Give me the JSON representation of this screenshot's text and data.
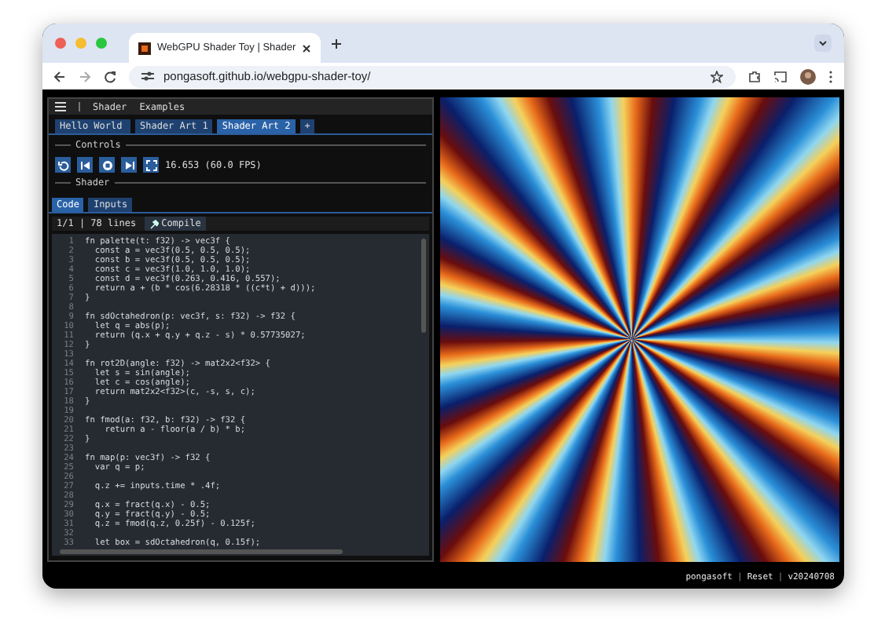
{
  "browser": {
    "tab_title": "WebGPU Shader Toy | Shader",
    "url": "pongasoft.github.io/webgpu-shader-toy/"
  },
  "menu": [
    "Shader",
    "Examples"
  ],
  "shader_tabs": [
    {
      "label": "Hello World",
      "selected": false
    },
    {
      "label": "Shader Art 1",
      "selected": false
    },
    {
      "label": "Shader Art 2",
      "selected": true
    }
  ],
  "add_tab": "+",
  "controls": {
    "heading": "Controls",
    "fps": "16.653 (60.0 FPS)"
  },
  "shader": {
    "heading": "Shader",
    "tabs": [
      {
        "label": "Code",
        "selected": true
      },
      {
        "label": "Inputs",
        "selected": false
      }
    ],
    "status": "1/1 | 78 lines",
    "compile": "Compile"
  },
  "code_lines": [
    {
      "number": "1",
      "text": "fn palette(t: f32) -> vec3f {"
    },
    {
      "number": "2",
      "text": "  const a = vec3f(0.5, 0.5, 0.5);"
    },
    {
      "number": "3",
      "text": "  const b = vec3f(0.5, 0.5, 0.5);"
    },
    {
      "number": "4",
      "text": "  const c = vec3f(1.0, 1.0, 1.0);"
    },
    {
      "number": "5",
      "text": "  const d = vec3f(0.263, 0.416, 0.557);"
    },
    {
      "number": "6",
      "text": "  return a + (b * cos(6.28318 * ((c*t) + d)));"
    },
    {
      "number": "7",
      "text": "}"
    },
    {
      "number": "8"
    },
    {
      "number": "9",
      "text": "fn sdOctahedron(p: vec3f, s: f32) -> f32 {"
    },
    {
      "number": "10",
      "text": "  let q = abs(p);"
    },
    {
      "number": "11",
      "text": "  return (q.x + q.y + q.z - s) * 0.57735027;"
    },
    {
      "number": "12",
      "text": "}"
    },
    {
      "number": "13"
    },
    {
      "number": "14",
      "text": "fn rot2D(angle: f32) -> mat2x2<f32> {"
    },
    {
      "number": "15",
      "text": "  let s = sin(angle);"
    },
    {
      "number": "16",
      "text": "  let c = cos(angle);"
    },
    {
      "number": "17",
      "text": "  return mat2x2<f32>(c, -s, s, c);"
    },
    {
      "number": "18",
      "text": "}"
    },
    {
      "number": "19"
    },
    {
      "number": "20",
      "text": "fn fmod(a: f32, b: f32) -> f32 {"
    },
    {
      "number": "21",
      "text": "    return a - floor(a / b) * b;"
    },
    {
      "number": "22",
      "text": "}"
    },
    {
      "number": "23"
    },
    {
      "number": "24",
      "text": "fn map(p: vec3f) -> f32 {"
    },
    {
      "number": "25",
      "text": "  var q = p;"
    },
    {
      "number": "26"
    },
    {
      "number": "27",
      "text": "  q.z += inputs.time * .4f;"
    },
    {
      "number": "28"
    },
    {
      "number": "29",
      "text": "  q.x = fract(q.x) - 0.5;"
    },
    {
      "number": "30",
      "text": "  q.y = fract(q.y) - 0.5;"
    },
    {
      "number": "31",
      "text": "  q.z = fmod(q.z, 0.25f) - 0.125f;"
    },
    {
      "number": "32"
    },
    {
      "number": "33",
      "text": "  let box = sdOctahedron(q, 0.15f);"
    }
  ],
  "footer": [
    {
      "kind": "link",
      "text": "pongasoft"
    },
    {
      "kind": "separator",
      "text": "|"
    },
    {
      "kind": "link",
      "text": "Reset"
    },
    {
      "kind": "separator",
      "text": "|"
    },
    {
      "kind": "link",
      "text": "v20240708"
    }
  ]
}
